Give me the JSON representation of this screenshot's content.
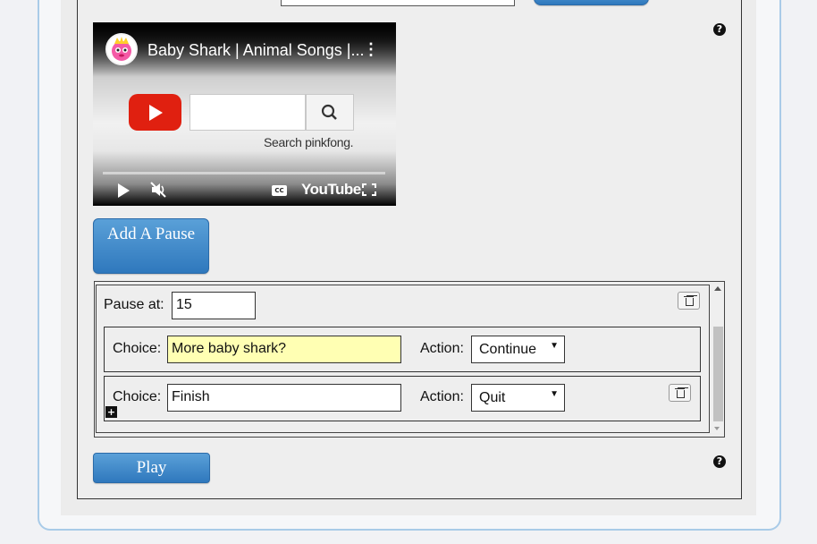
{
  "video": {
    "title": "Baby Shark | Animal Songs |...",
    "menu_glyph": "⋮",
    "search_caption": "Search pinkfong.",
    "cc_label": "CC",
    "logo_text": "YouTube",
    "mute_glyph": "🔇"
  },
  "buttons": {
    "add_pause": "Add A Pause",
    "play": "Play"
  },
  "help_glyph": "?",
  "pause": {
    "label": "Pause at:",
    "value": "15"
  },
  "choices": [
    {
      "choice_label": "Choice:",
      "value": "More baby shark?",
      "action_label": "Action:",
      "action": "Continue",
      "highlight_color": "#ffffb3"
    },
    {
      "choice_label": "Choice:",
      "value": "Finish",
      "action_label": "Action:",
      "action": "Quit",
      "highlight_color": "#ffffff"
    }
  ],
  "add_choice_glyph": "+",
  "colors": {
    "button_blue": "#3a84c6",
    "frame_blue": "#a9cbe8"
  }
}
